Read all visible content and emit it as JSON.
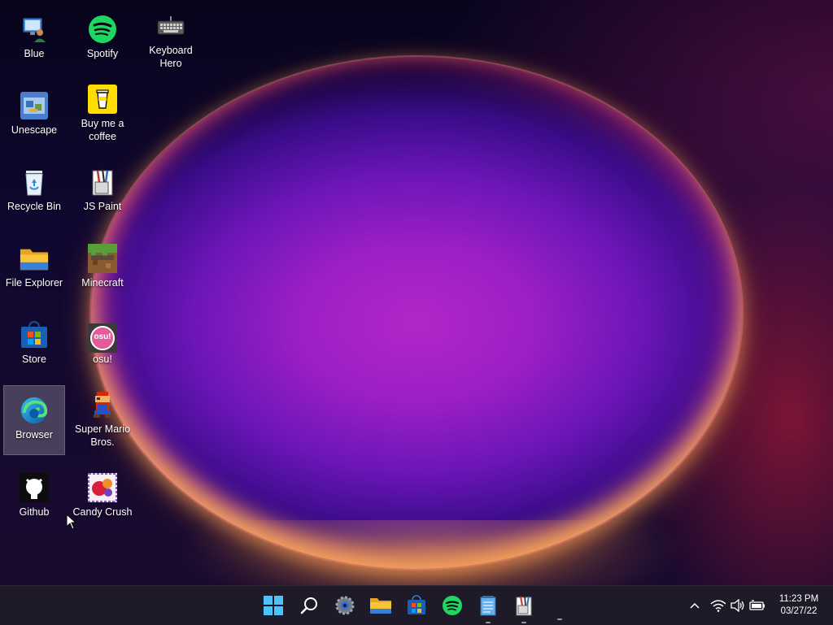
{
  "desktop": {
    "icons": [
      {
        "label": "Blue",
        "icon": "blue-user-monitor-icon"
      },
      {
        "label": "Spotify",
        "icon": "spotify-icon",
        "color": "#1ed760"
      },
      {
        "label": "Keyboard\nHero",
        "icon": "keyboard-icon"
      },
      {
        "label": "Unescape",
        "icon": "unescape-icon"
      },
      {
        "label": "Buy me a\ncoffee",
        "icon": "coffee-cup-icon",
        "color": "#ffdd00"
      },
      {
        "label": "Recycle Bin",
        "icon": "recycle-bin-icon"
      },
      {
        "label": "JS Paint",
        "icon": "paint-icon"
      },
      {
        "label": "File Explorer",
        "icon": "folder-icon",
        "color": "#f8c53a"
      },
      {
        "label": "Minecraft",
        "icon": "minecraft-icon"
      },
      {
        "label": "Store",
        "icon": "store-icon"
      },
      {
        "label": "osu!",
        "icon": "osu-icon",
        "color": "#e45a9a",
        "badge": "osu!"
      },
      {
        "label": "Browser",
        "icon": "edge-browser-icon",
        "selected": true
      },
      {
        "label": "Super Mario\nBros.",
        "icon": "mario-icon"
      },
      {
        "label": "Github",
        "icon": "github-icon"
      },
      {
        "label": "Candy Crush",
        "icon": "candy-crush-icon"
      }
    ]
  },
  "taskbar": {
    "apps": [
      {
        "name": "start",
        "icon": "windows-start-icon"
      },
      {
        "name": "search",
        "icon": "search-icon"
      },
      {
        "name": "settings",
        "icon": "settings-icon"
      },
      {
        "name": "file-explorer",
        "icon": "folder-icon"
      },
      {
        "name": "store",
        "icon": "store-icon"
      },
      {
        "name": "spotify",
        "icon": "spotify-icon"
      },
      {
        "name": "notepad",
        "icon": "notepad-icon"
      },
      {
        "name": "js-paint",
        "icon": "paint-icon"
      }
    ],
    "tray": {
      "overflow_icon": "chevron-up-icon",
      "wifi_icon": "wifi-icon",
      "volume_icon": "volume-icon",
      "battery_icon": "battery-icon"
    },
    "clock": {
      "time": "11:23 PM",
      "date": "03/27/22"
    }
  },
  "colors": {
    "taskbar_bg": "#1f1a27",
    "accent": "#0078d4"
  }
}
